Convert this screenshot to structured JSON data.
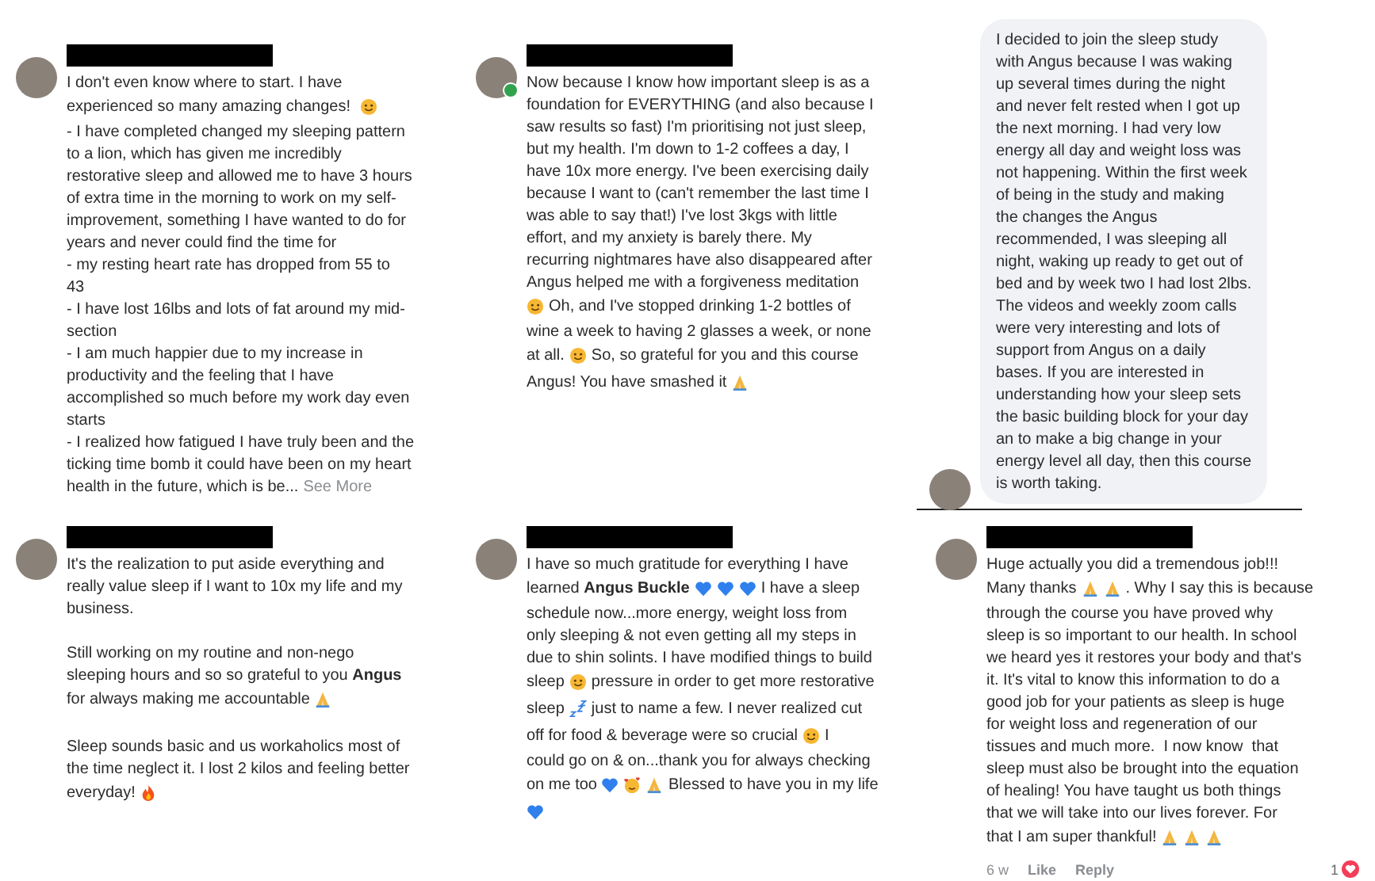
{
  "comments": [
    {
      "kind": "plain",
      "online": false,
      "paragraphs": [
        [
          [
            {
              "kind": "text",
              "text": "I don't even know where to start. I have"
            }
          ],
          [
            {
              "kind": "text",
              "text": "experienced so many amazing changes! "
            },
            {
              "kind": "smiley"
            }
          ],
          [
            {
              "kind": "text",
              "text": "- I have completed changed my sleeping pattern"
            }
          ],
          [
            {
              "kind": "text",
              "text": "to a lion, which has given me incredibly"
            }
          ],
          [
            {
              "kind": "text",
              "text": "restorative sleep and allowed me to have 3 hours"
            }
          ],
          [
            {
              "kind": "text",
              "text": "of extra time in the morning to work on my self-"
            }
          ],
          [
            {
              "kind": "text",
              "text": "improvement, something I have wanted to do for"
            }
          ],
          [
            {
              "kind": "text",
              "text": "years and never could find the time for"
            }
          ],
          [
            {
              "kind": "text",
              "text": "- my resting heart rate has dropped from 55 to"
            }
          ],
          [
            {
              "kind": "text",
              "text": "43"
            }
          ],
          [
            {
              "kind": "text",
              "text": "- I have lost 16lbs and lots of fat around my mid-"
            }
          ],
          [
            {
              "kind": "text",
              "text": "section"
            }
          ],
          [
            {
              "kind": "text",
              "text": "- I am much happier due to my increase in"
            }
          ],
          [
            {
              "kind": "text",
              "text": "productivity and the feeling that I have"
            }
          ],
          [
            {
              "kind": "text",
              "text": "accomplished so much before my work day even"
            }
          ],
          [
            {
              "kind": "text",
              "text": "starts"
            }
          ],
          [
            {
              "kind": "text",
              "text": "- I realized how fatigued I have truly been and the"
            }
          ],
          [
            {
              "kind": "text",
              "text": "ticking time bomb it could have been on my heart"
            }
          ],
          [
            {
              "kind": "text",
              "text": "health in the future, which is be..."
            },
            {
              "kind": "link",
              "text": "See More"
            }
          ]
        ]
      ]
    },
    {
      "kind": "plain",
      "online": true,
      "paragraphs": [
        [
          [
            {
              "kind": "text",
              "text": "Now because I know how important sleep is as a"
            }
          ],
          [
            {
              "kind": "text",
              "text": "foundation for EVERYTHING (and also because I"
            }
          ],
          [
            {
              "kind": "text",
              "text": "saw results so fast) I'm prioritising not just sleep,"
            }
          ],
          [
            {
              "kind": "text",
              "text": "but my health. I'm down to 1-2 coffees a day, I"
            }
          ],
          [
            {
              "kind": "text",
              "text": "have 10x more energy. I've been exercising daily"
            }
          ],
          [
            {
              "kind": "text",
              "text": "because I want to (can't remember the last time I"
            }
          ],
          [
            {
              "kind": "text",
              "text": "was able to say that!) I've lost 3kgs with little"
            }
          ],
          [
            {
              "kind": "text",
              "text": "effort, and my anxiety is barely there. My"
            }
          ],
          [
            {
              "kind": "text",
              "text": "recurring nightmares have also disappeared after"
            }
          ],
          [
            {
              "kind": "text",
              "text": "Angus helped me with a forgiveness meditation"
            }
          ],
          [
            {
              "kind": "smiley"
            },
            {
              "kind": "text",
              "text": "Oh, and I've stopped drinking 1-2 bottles of"
            }
          ],
          [
            {
              "kind": "text",
              "text": "wine a week to having 2 glasses a week, or none"
            }
          ],
          [
            {
              "kind": "text",
              "text": "at all."
            },
            {
              "kind": "smiley"
            },
            {
              "kind": "text",
              "text": "So, so grateful for you and this course"
            }
          ],
          [
            {
              "kind": "text",
              "text": "Angus! You have smashed it"
            },
            {
              "kind": "pray"
            }
          ]
        ]
      ]
    },
    {
      "kind": "bubble",
      "online": false,
      "paragraphs": [
        [
          [
            {
              "kind": "text",
              "text": "I decided to join the sleep study"
            }
          ],
          [
            {
              "kind": "text",
              "text": "with Angus because I was waking"
            }
          ],
          [
            {
              "kind": "text",
              "text": "up several times during the night"
            }
          ],
          [
            {
              "kind": "text",
              "text": "and never felt rested when I got up"
            }
          ],
          [
            {
              "kind": "text",
              "text": "the next morning. I had very low"
            }
          ],
          [
            {
              "kind": "text",
              "text": "energy all day and weight loss was"
            }
          ],
          [
            {
              "kind": "text",
              "text": "not happening. Within the first week"
            }
          ],
          [
            {
              "kind": "text",
              "text": "of being in the study and making"
            }
          ],
          [
            {
              "kind": "text",
              "text": "the changes the Angus"
            }
          ],
          [
            {
              "kind": "text",
              "text": "recommended, I was sleeping all"
            }
          ],
          [
            {
              "kind": "text",
              "text": "night, waking up ready to get out of"
            }
          ],
          [
            {
              "kind": "text",
              "text": "bed and by week two I had lost 2lbs."
            }
          ],
          [
            {
              "kind": "text",
              "text": "The videos and weekly zoom calls"
            }
          ],
          [
            {
              "kind": "text",
              "text": "were very interesting and lots of"
            }
          ],
          [
            {
              "kind": "text",
              "text": "support from Angus on a daily"
            }
          ],
          [
            {
              "kind": "text",
              "text": "bases. If you are interested in"
            }
          ],
          [
            {
              "kind": "text",
              "text": "understanding how your sleep sets"
            }
          ],
          [
            {
              "kind": "text",
              "text": "the basic building block for your day"
            }
          ],
          [
            {
              "kind": "text",
              "text": "an to make a big change in your"
            }
          ],
          [
            {
              "kind": "text",
              "text": "energy level all day, then this course"
            }
          ],
          [
            {
              "kind": "text",
              "text": "is worth taking."
            }
          ]
        ]
      ]
    },
    {
      "kind": "plain",
      "online": false,
      "paragraphs": [
        [
          [
            {
              "kind": "text",
              "text": "It's the realization to put aside everything and"
            }
          ],
          [
            {
              "kind": "text",
              "text": "really value sleep if I want to 10x my life and my"
            }
          ],
          [
            {
              "kind": "text",
              "text": "business."
            }
          ]
        ],
        [
          [
            {
              "kind": "text",
              "text": "Still working on my routine and non-nego"
            }
          ],
          [
            {
              "kind": "text",
              "text": "sleeping hours and so so grateful to you **Angus**"
            }
          ],
          [
            {
              "kind": "text",
              "text": "for always making me accountable"
            },
            {
              "kind": "pray"
            }
          ]
        ],
        [
          [
            {
              "kind": "text",
              "text": "Sleep sounds basic and us workaholics most of"
            }
          ],
          [
            {
              "kind": "text",
              "text": "the time neglect it. I lost 2 kilos and feeling better"
            }
          ],
          [
            {
              "kind": "text",
              "text": "everyday!"
            },
            {
              "kind": "fire"
            }
          ]
        ]
      ]
    },
    {
      "kind": "plain",
      "online": false,
      "paragraphs": [
        [
          [
            {
              "kind": "text",
              "text": "I have so much gratitude for everything I have"
            }
          ],
          [
            {
              "kind": "text",
              "text": "learned **Angus Buckle**"
            },
            {
              "kind": "heart"
            },
            {
              "kind": "heart"
            },
            {
              "kind": "heart"
            },
            {
              "kind": "text",
              "text": "I have a sleep"
            }
          ],
          [
            {
              "kind": "text",
              "text": "schedule now...more energy, weight loss from"
            }
          ],
          [
            {
              "kind": "text",
              "text": "only sleeping & not even getting all my steps in"
            }
          ],
          [
            {
              "kind": "text",
              "text": "due to shin solints. I have modified things to build"
            }
          ],
          [
            {
              "kind": "text",
              "text": "sleep"
            },
            {
              "kind": "smiley"
            },
            {
              "kind": "text",
              "text": "pressure in order to get more restorative"
            }
          ],
          [
            {
              "kind": "text",
              "text": "sleep"
            },
            {
              "kind": "zzz"
            },
            {
              "kind": "text",
              "text": "just to name a few. I never realized cut"
            }
          ],
          [
            {
              "kind": "text",
              "text": "off for food & beverage were so crucial"
            },
            {
              "kind": "smiley"
            },
            {
              "kind": "text",
              "text": "I"
            }
          ],
          [
            {
              "kind": "text",
              "text": "could go on & on...thank you for always checking"
            }
          ],
          [
            {
              "kind": "text",
              "text": "on me too"
            },
            {
              "kind": "heart"
            },
            {
              "kind": "hug"
            },
            {
              "kind": "pray"
            },
            {
              "kind": "text",
              "text": "Blessed to have you in my life"
            }
          ],
          [
            {
              "kind": "heart"
            }
          ]
        ]
      ]
    },
    {
      "kind": "plain",
      "online": false,
      "paragraphs": [
        [
          [
            {
              "kind": "text",
              "text": "Huge actually you did a tremendous job!!!"
            }
          ],
          [
            {
              "kind": "text",
              "text": "Many thanks"
            },
            {
              "kind": "pray"
            },
            {
              "kind": "pray"
            },
            {
              "kind": "text",
              "text": ". Why I say this is because"
            }
          ],
          [
            {
              "kind": "text",
              "text": "through the course you have proved why"
            }
          ],
          [
            {
              "kind": "text",
              "text": "sleep is so important to our health. In school"
            }
          ],
          [
            {
              "kind": "text",
              "text": "we heard yes it restores your body and that's"
            }
          ],
          [
            {
              "kind": "text",
              "text": "it. It's vital to know this information to do a"
            }
          ],
          [
            {
              "kind": "text",
              "text": "good job for your patients as sleep is huge"
            }
          ],
          [
            {
              "kind": "text",
              "text": "for weight loss and regeneration of our"
            }
          ],
          [
            {
              "kind": "text",
              "text": "tissues and much more.  I now know  that"
            }
          ],
          [
            {
              "kind": "text",
              "text": "sleep must also be brought into the equation"
            }
          ],
          [
            {
              "kind": "text",
              "text": "of healing! You have taught us both things"
            }
          ],
          [
            {
              "kind": "text",
              "text": "that we will take into our lives forever. For"
            }
          ],
          [
            {
              "kind": "text",
              "text": "that I am super thankful!"
            },
            {
              "kind": "pray"
            },
            {
              "kind": "pray"
            },
            {
              "kind": "pray"
            }
          ]
        ]
      ],
      "footer": {
        "time": "6 w",
        "actions": [
          "Like",
          "Reply"
        ],
        "reaction_count": "1"
      }
    }
  ]
}
